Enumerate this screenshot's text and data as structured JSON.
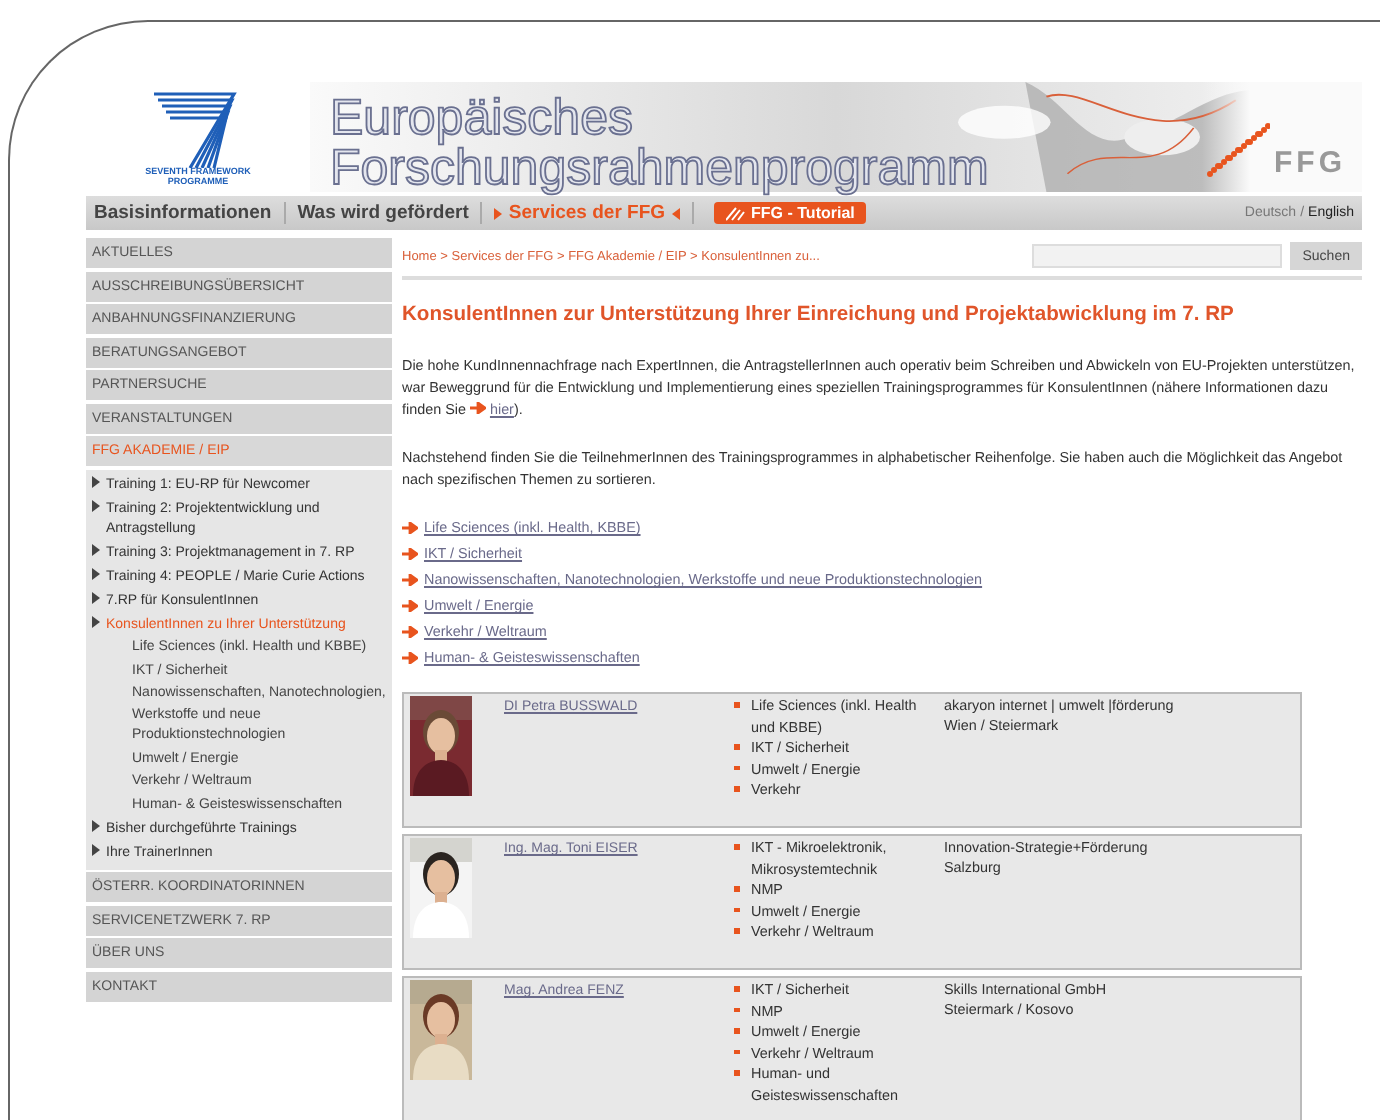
{
  "header": {
    "logo_caption": [
      "SEVENTH FRAMEWORK",
      "PROGRAMME"
    ],
    "banner_title": [
      "Europäisches",
      "Forschungsrahmenprogramm"
    ],
    "brand": "FFG"
  },
  "nav": [
    {
      "label": "Basisinformationen",
      "kind": "tab",
      "selected": false
    },
    {
      "label": "Was wird gefördert",
      "kind": "tab",
      "selected": false
    },
    {
      "label": "Services der FFG",
      "kind": "tab",
      "selected": true
    },
    {
      "label": "FFG - Tutorial",
      "kind": "tutorial",
      "selected": false
    }
  ],
  "languages": [
    {
      "label": "Deutsch",
      "selected": false
    },
    {
      "label": "/",
      "selected": false
    },
    {
      "label": "English",
      "selected": true
    }
  ],
  "sidebar": [
    {
      "label": "AKTUELLES",
      "selected": false
    },
    {
      "label": "AUSSCHREIBUNGSÜBERSICHT",
      "selected": false
    },
    {
      "label": "ANBAHNUNGSFINANZIERUNG",
      "selected": false
    },
    {
      "label": "BERATUNGSANGEBOT",
      "selected": false
    },
    {
      "label": "PARTNERSUCHE",
      "selected": false
    },
    {
      "label": "VERANSTALTUNGEN",
      "selected": false
    },
    {
      "label": "FFG AKADEMIE / EIP",
      "selected": true,
      "children": [
        {
          "label": "Training 1: EU-RP für Newcomer",
          "selected": false
        },
        {
          "label": "Training 2: Projektentwicklung und Antragstellung",
          "selected": false
        },
        {
          "label": "Training 3: Projektmanagement in 7. RP",
          "selected": false
        },
        {
          "label": "Training 4: PEOPLE / Marie Curie Actions",
          "selected": false
        },
        {
          "label": "7.RP für KonsulentInnen",
          "selected": false
        },
        {
          "label": "KonsulentInnen zu Ihrer Unterstützung",
          "selected": true,
          "children": [
            {
              "label": "Life Sciences (inkl. Health und KBBE)",
              "selected": false
            },
            {
              "label": "IKT / Sicherheit",
              "selected": false
            },
            {
              "label": "Nanowissenschaften, Nanotechnologien, Werkstoffe und neue Produktionstechnologien",
              "selected": false
            },
            {
              "label": "Umwelt / Energie",
              "selected": false
            },
            {
              "label": "Verkehr / Weltraum",
              "selected": false
            },
            {
              "label": "Human- & Geisteswissenschaften",
              "selected": false
            }
          ]
        },
        {
          "label": "Bisher durchgeführte Trainings",
          "selected": false
        },
        {
          "label": "Ihre TrainerInnen",
          "selected": false
        }
      ]
    },
    {
      "label": "ÖSTERR. KOORDINATORINNEN",
      "selected": false
    },
    {
      "label": "SERVICENETZWERK 7. RP",
      "selected": false
    },
    {
      "label": "ÜBER UNS",
      "selected": false
    },
    {
      "label": "KONTAKT",
      "selected": false
    }
  ],
  "breadcrumb": "Home > Services der FFG > FFG Akademie / EIP > KonsulentInnen zu...",
  "search": {
    "button": "Suchen"
  },
  "title": "KonsulentInnen zur Unterstützung Ihrer Einreichung und Projektabwicklung im 7. RP",
  "intro": {
    "text": "Die hohe KundInnennachfrage nach ExpertInnen, die AntragstellerInnen auch operativ beim Schreiben und Abwickeln von EU-Projekten unterstützen, war Beweggrund für die Entwicklung und Implementierung eines speziellen Trainingsprogrammes für KonsulentInnen (nähere Informationen dazu finden Sie",
    "link": "hier",
    "after": ")."
  },
  "intro2": "Nachstehend finden Sie die TeilnehmerInnen des Trainingsprogrammes in alphabetischer Reihenfolge. Sie haben auch die Möglichkeit das Angebot nach spezifischen Themen zu sortieren.",
  "topic_links": [
    "Life Sciences (inkl. Health, KBBE)",
    "IKT / Sicherheit",
    "Nanowissenschaften, Nanotechnologien, Werkstoffe und neue Produktionstechnologien",
    "Umwelt / Energie",
    "Verkehr / Weltraum",
    "Human- & Geisteswissenschaften"
  ],
  "consultants": [
    {
      "name": "DI Petra BUSSWALD",
      "topics": [
        "Life Sciences (inkl. Health und KBBE)",
        "IKT / Sicherheit",
        "Umwelt / Energie",
        "Verkehr"
      ],
      "organization": "akaryon internet | umwelt |förderung",
      "region": "Wien / Steiermark"
    },
    {
      "name": "Ing. Mag. Toni EISER",
      "topics": [
        "IKT - Mikroelektronik, Mikrosystemtechnik",
        "NMP",
        "Umwelt / Energie",
        "Verkehr / Weltraum"
      ],
      "organization": "Innovation-Strategie+Förderung",
      "region": "Salzburg"
    },
    {
      "name": "Mag. Andrea FENZ",
      "topics": [
        "IKT / Sicherheit",
        "NMP",
        "Umwelt / Energie",
        "Verkehr / Weltraum",
        "Human- und Geisteswissenschaften"
      ],
      "organization": "Skills International GmbH",
      "region": "Steiermark / Kosovo"
    }
  ]
}
